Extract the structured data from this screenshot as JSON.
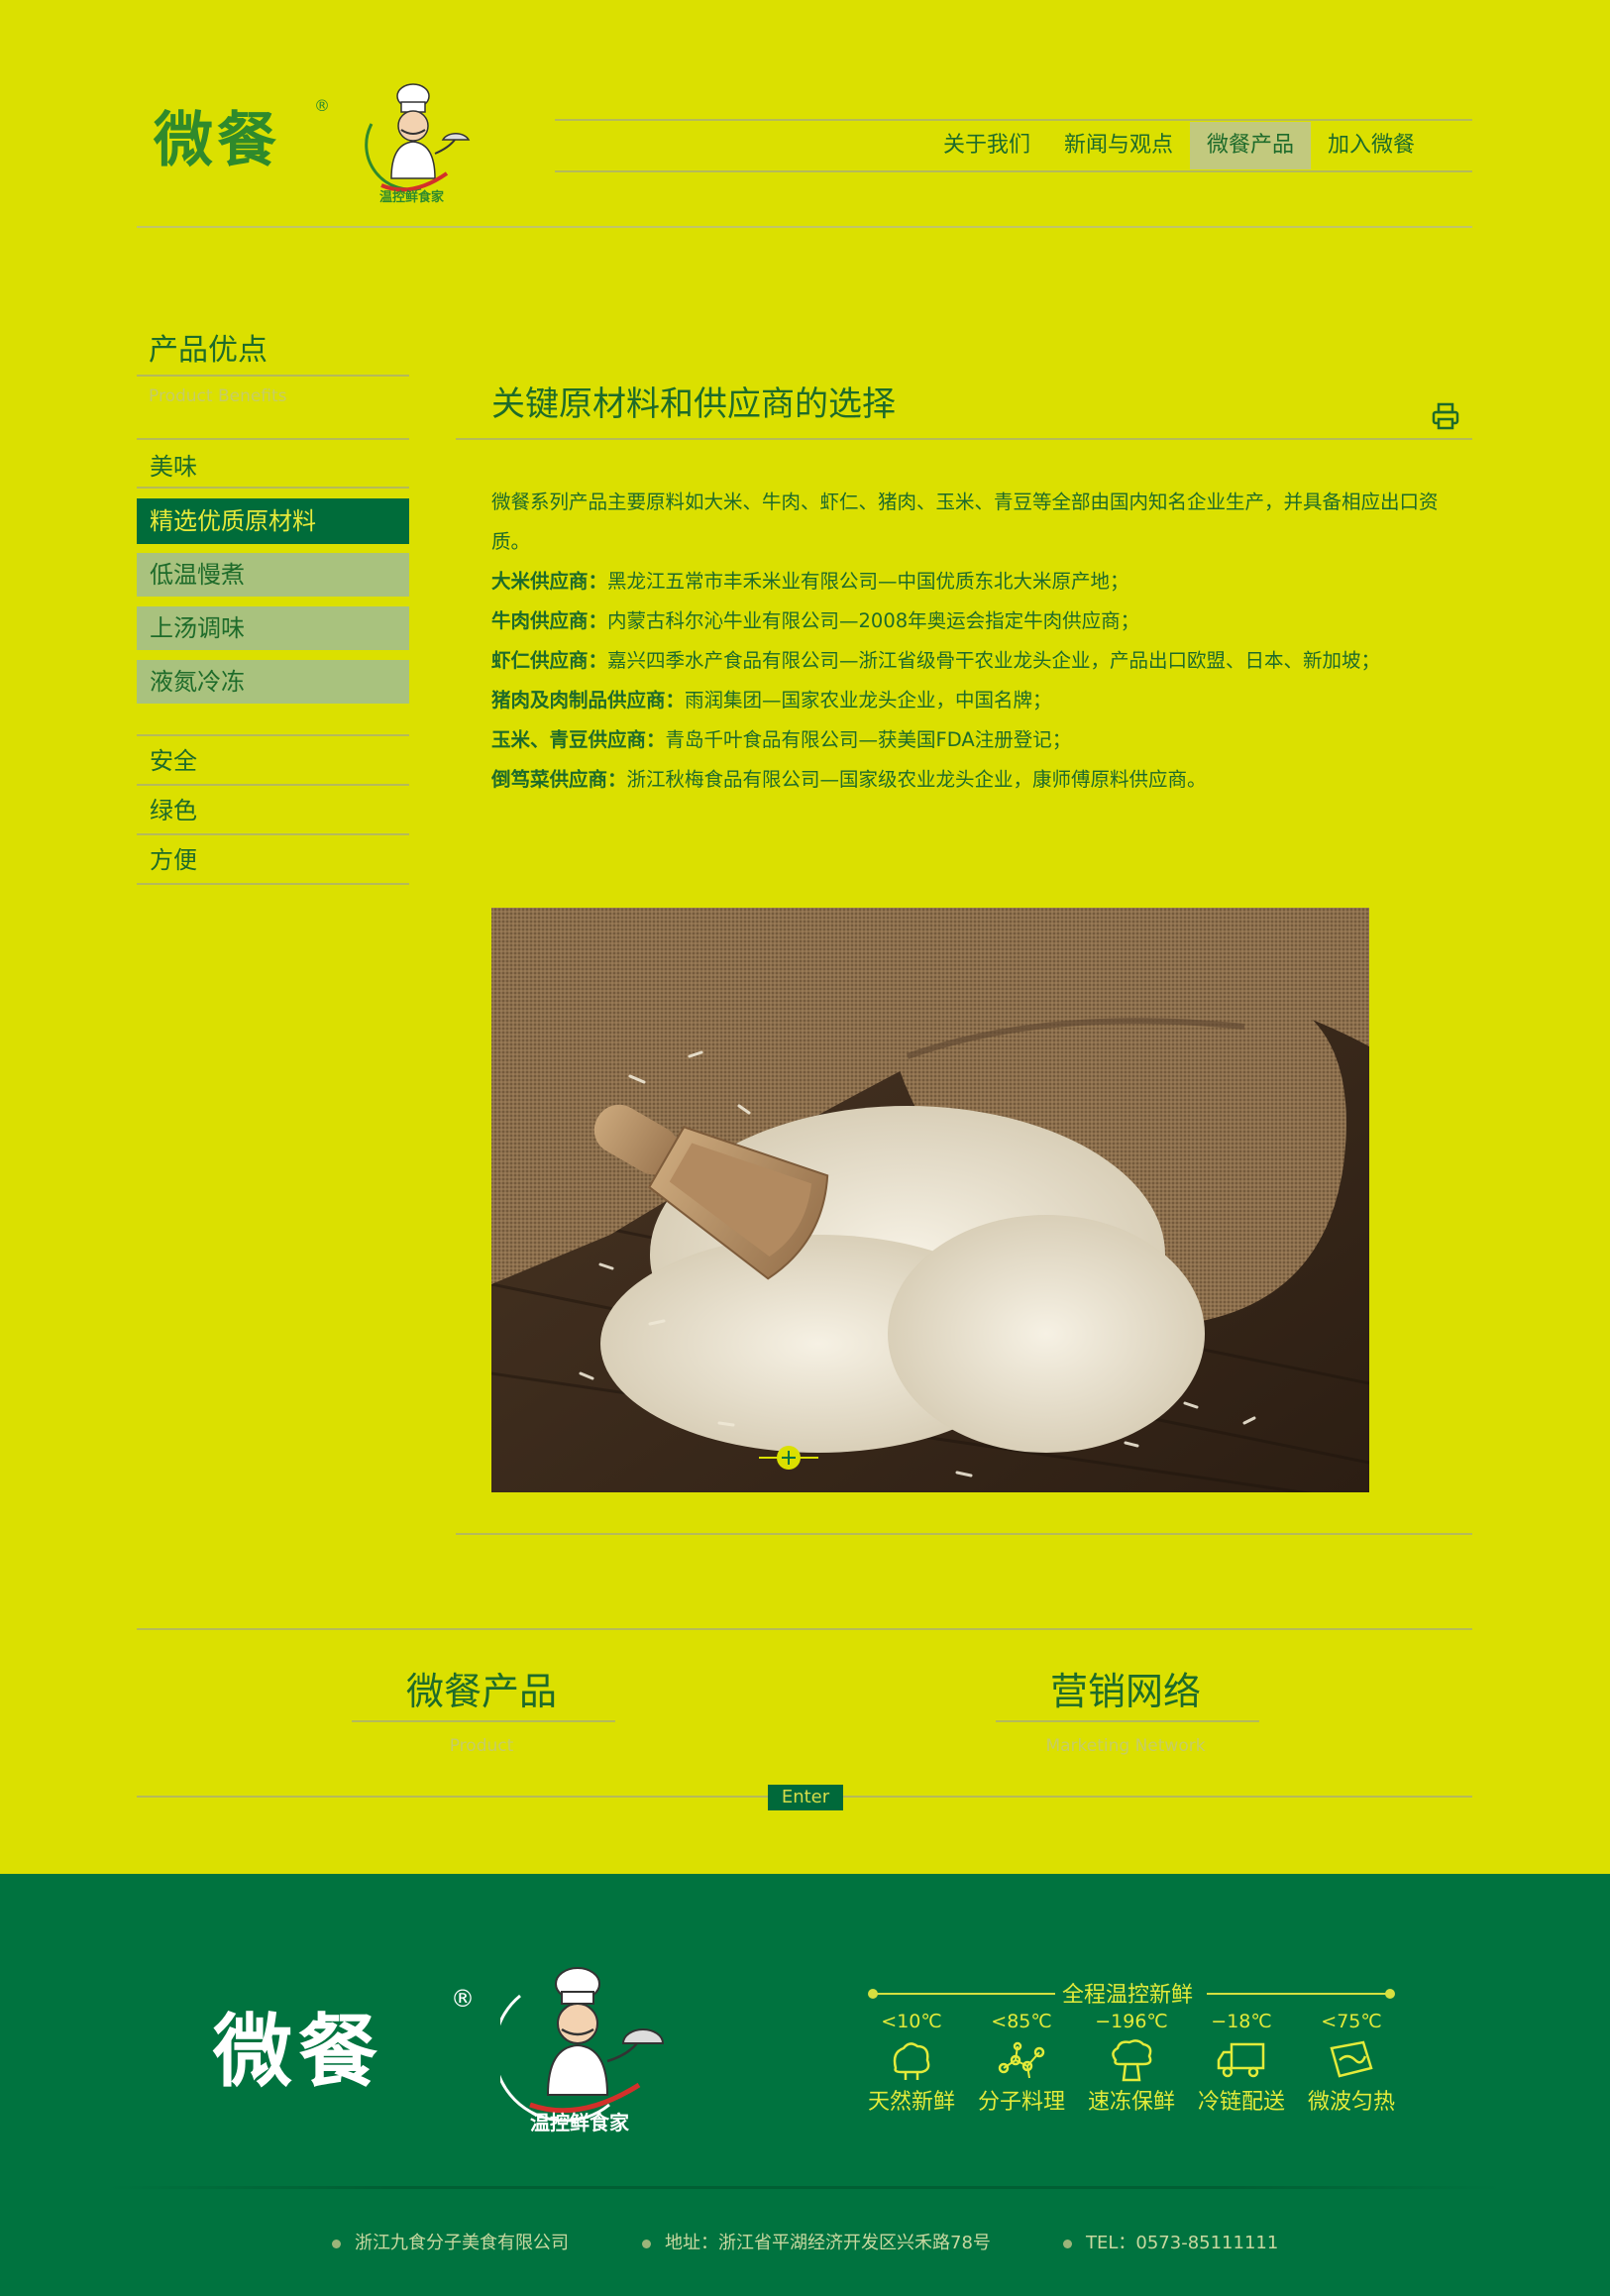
{
  "brand": {
    "name": "微餐",
    "reg": "®",
    "tagline": "温控鲜食家"
  },
  "nav": {
    "items": [
      {
        "label": "关于我们",
        "active": false
      },
      {
        "label": "新闻与观点",
        "active": false
      },
      {
        "label": "微餐产品",
        "active": true
      },
      {
        "label": "加入微餐",
        "active": false
      }
    ]
  },
  "sidebar": {
    "title": "产品优点",
    "subtitle": "Product Benefits",
    "items": [
      {
        "label": "美味"
      },
      {
        "label": "精选优质原材料"
      },
      {
        "label": "低温慢煮"
      },
      {
        "label": "上汤调味"
      },
      {
        "label": "液氮冷冻"
      },
      {
        "label": "安全"
      },
      {
        "label": "绿色"
      },
      {
        "label": "方便"
      }
    ]
  },
  "content": {
    "title": "关键原材料和供应商的选择",
    "intro": "微餐系列产品主要原料如大米、牛肉、虾仁、猪肉、玉米、青豆等全部由国内知名企业生产，并具备相应出口资质。",
    "suppliers": [
      {
        "label": "大米供应商：",
        "text": "黑龙江五常市丰禾米业有限公司—中国优质东北大米原产地；"
      },
      {
        "label": "牛肉供应商：",
        "text": "内蒙古科尔沁牛业有限公司—2008年奥运会指定牛肉供应商；"
      },
      {
        "label": "虾仁供应商：",
        "text": "嘉兴四季水产食品有限公司—浙江省级骨干农业龙头企业，产品出口欧盟、日本、新加坡；"
      },
      {
        "label": "猪肉及肉制品供应商：",
        "text": "雨润集团—国家农业龙头企业，中国名牌；"
      },
      {
        "label": "玉米、青豆供应商：",
        "text": "青岛千叶食品有限公司—获美国FDA注册登记；"
      },
      {
        "label": "倒笃菜供应商：",
        "text": "浙江秋梅食品有限公司—国家级农业龙头企业，康师傅原料供应商。"
      }
    ]
  },
  "lower": {
    "left_title": "微餐产品",
    "left_sub": "Product",
    "right_title": "营销网络",
    "right_sub": "Marketing Network",
    "enter": "Enter"
  },
  "footer": {
    "badge_title": "全程温控新鲜",
    "features": [
      {
        "temp": "<10℃",
        "label": "天然新鲜",
        "icon": "vegetable-icon"
      },
      {
        "temp": "<85℃",
        "label": "分子料理",
        "icon": "molecule-icon"
      },
      {
        "temp": "−196℃",
        "label": "速冻保鲜",
        "icon": "broccoli-icon"
      },
      {
        "temp": "−18℃",
        "label": "冷链配送",
        "icon": "truck-icon"
      },
      {
        "temp": "<75℃",
        "label": "微波匀热",
        "icon": "microwave-icon"
      }
    ],
    "company": "浙江九食分子美食有限公司",
    "address": "地址：浙江省平湖经济开发区兴禾路78号",
    "tel": "TEL：0573-85111111"
  },
  "colors": {
    "background": "#dbe000",
    "primary_green": "#00733f",
    "text_green": "#1e6b2a",
    "accent_yellow": "#e3eb3a"
  }
}
